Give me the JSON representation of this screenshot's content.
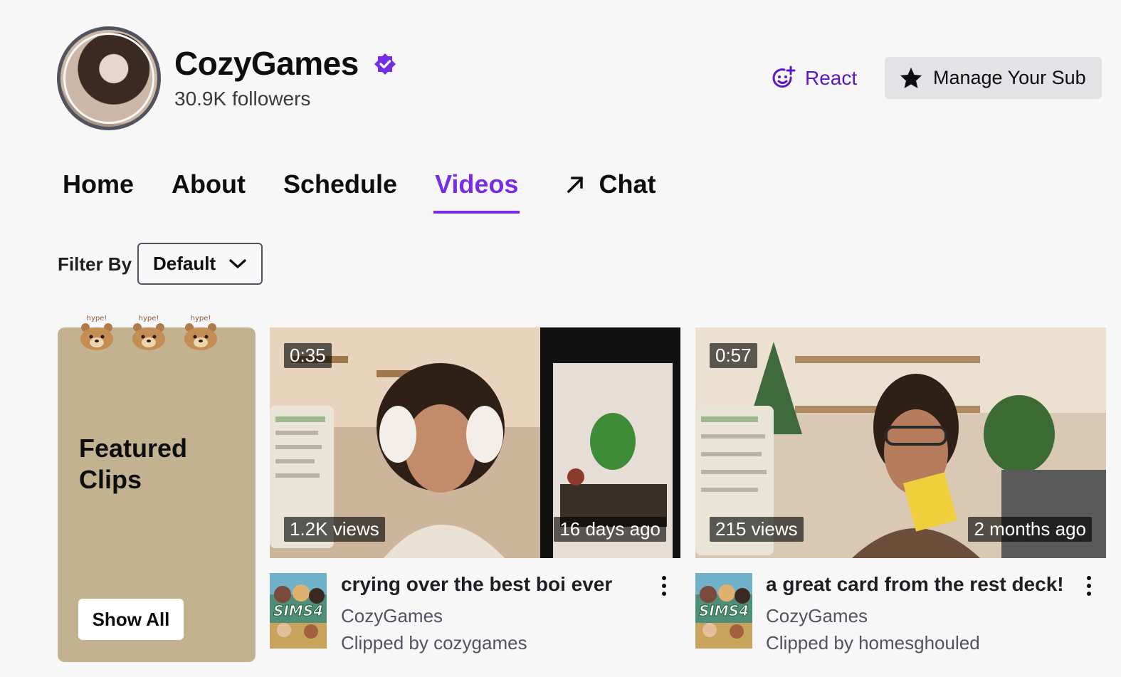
{
  "channel": {
    "name": "CozyGames",
    "followers": "30.9K followers"
  },
  "actions": {
    "react_label": "React",
    "sub_label": "Manage Your Sub"
  },
  "tabs": [
    {
      "label": "Home"
    },
    {
      "label": "About"
    },
    {
      "label": "Schedule"
    },
    {
      "label": "Videos"
    },
    {
      "label": "Chat"
    }
  ],
  "filter": {
    "label": "Filter By",
    "value": "Default"
  },
  "featured": {
    "title_line1": "Featured",
    "title_line2": "Clips",
    "show_all": "Show All",
    "bear_text": "hype!"
  },
  "clips": [
    {
      "duration": "0:35",
      "views": "1.2K views",
      "age": "16 days ago",
      "title": "crying over the best boi ever",
      "channel": "CozyGames",
      "clipped_by": "Clipped by cozygames",
      "game_logo": "SIMS4"
    },
    {
      "duration": "0:57",
      "views": "215 views",
      "age": "2 months ago",
      "title": "a great card from the rest deck!",
      "channel": "CozyGames",
      "clipped_by": "Clipped by homesghouled",
      "game_logo": "SIMS4"
    }
  ],
  "colors": {
    "accent": "#772ce8",
    "react": "#5c16c5",
    "featured_bg": "#c2b290",
    "page_bg": "#f7f7f8"
  }
}
